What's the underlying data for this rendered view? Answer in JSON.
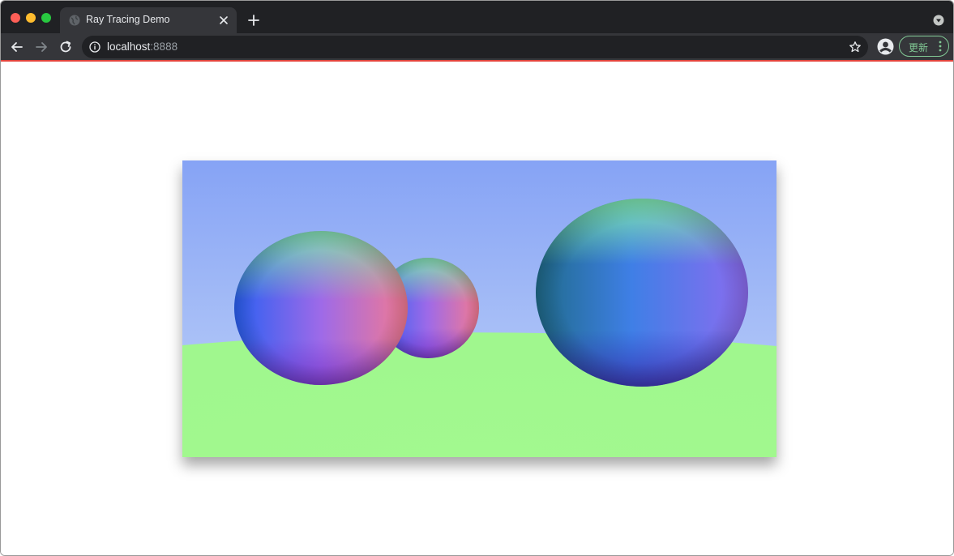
{
  "browser": {
    "tab": {
      "title": "Ray Tracing Demo",
      "favicon": "globe-icon"
    },
    "address_bar": {
      "host": "localhost",
      "port": ":8888"
    },
    "update_button": {
      "label": "更新"
    },
    "colors": {
      "frame": "#202124",
      "toolbar": "#35363a",
      "accent_line": "#e2443d",
      "update_green": "#81c995"
    }
  },
  "canvas": {
    "description_type": "ray-traced scene rendered with surface normals as colors",
    "colors": {
      "sky_top": "#86a3f5",
      "sky_bottom": "#bfd2f8",
      "ground": "#a1f88f"
    }
  }
}
